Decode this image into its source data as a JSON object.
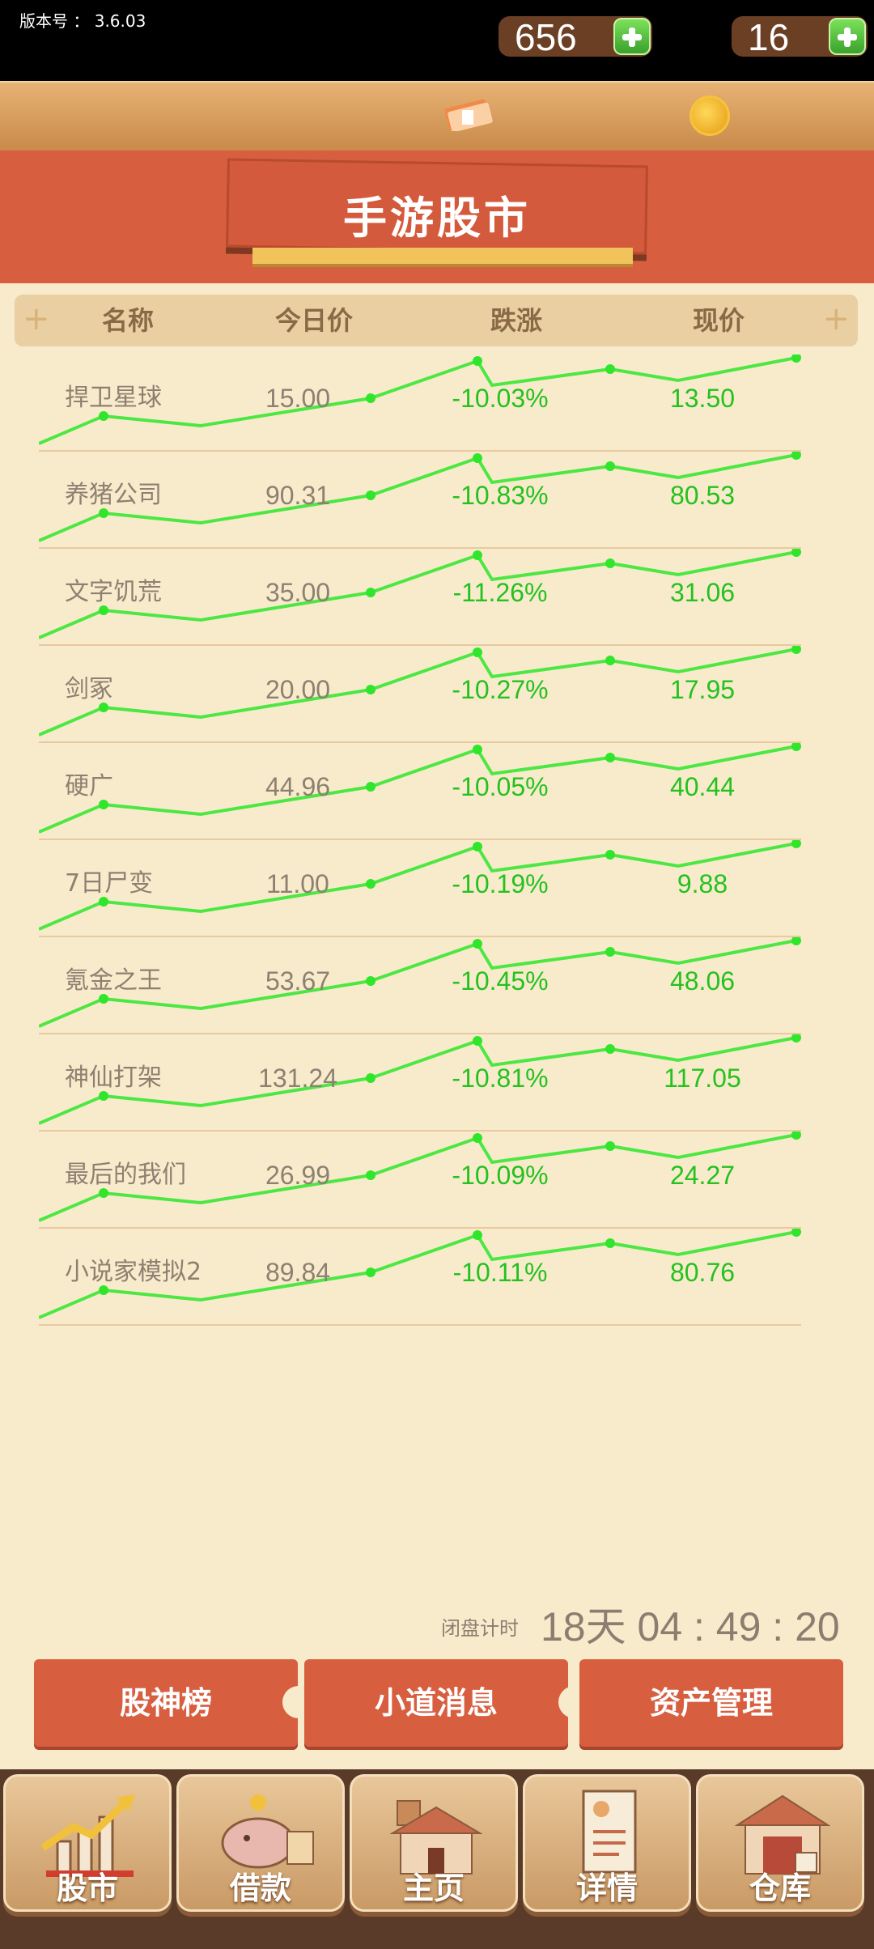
{
  "version": "版本号 ： 3.6.03",
  "currency": {
    "cash": "656",
    "coins": "16"
  },
  "title": "手游股市",
  "table": {
    "headers": [
      "名称",
      "今日价",
      "跌涨",
      "现价"
    ],
    "rows": [
      {
        "name": "捍卫星球",
        "price": "15.00",
        "change": "-10.03%",
        "now": "13.50"
      },
      {
        "name": "养猪公司",
        "price": "90.31",
        "change": "-10.83%",
        "now": "80.53"
      },
      {
        "name": "文字饥荒",
        "price": "35.00",
        "change": "-11.26%",
        "now": "31.06"
      },
      {
        "name": "剑冢",
        "price": "20.00",
        "change": "-10.27%",
        "now": "17.95"
      },
      {
        "name": "硬广",
        "price": "44.96",
        "change": "-10.05%",
        "now": "40.44"
      },
      {
        "name": "7日尸变",
        "price": "11.00",
        "change": "-10.19%",
        "now": "9.88"
      },
      {
        "name": "氪金之王",
        "price": "53.67",
        "change": "-10.45%",
        "now": "48.06"
      },
      {
        "name": "神仙打架",
        "price": "131.24",
        "change": "-10.81%",
        "now": "117.05"
      },
      {
        "name": "最后的我们",
        "price": "26.99",
        "change": "-10.09%",
        "now": "24.27"
      },
      {
        "name": "小说家模拟2",
        "price": "89.84",
        "change": "-10.11%",
        "now": "80.76"
      }
    ]
  },
  "countdown": {
    "label": "闭盘计时",
    "value": "18天 04 : 49 : 20"
  },
  "actions": [
    "股神榜",
    "小道消息",
    "资产管理"
  ],
  "nav": [
    "股市",
    "借款",
    "主页",
    "详情",
    "仓库"
  ],
  "colors": {
    "banner": "#d75f40",
    "up_green": "#25c11f",
    "background": "#f8ebcc"
  }
}
